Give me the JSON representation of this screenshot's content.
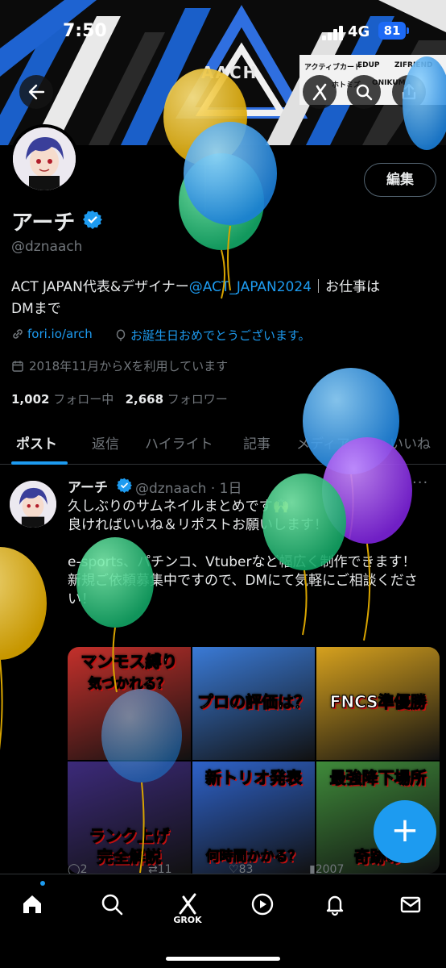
{
  "status_bar": {
    "time": "7:50",
    "network": "4G",
    "battery": "81"
  },
  "banner": {
    "title": "AACH",
    "sponsors": [
      "アクティブカード",
      "EDUP",
      "ZIFRIEND",
      "ホトミズ",
      "ONIKUMA"
    ]
  },
  "profile": {
    "display_name": "アーチ",
    "handle": "@dznaach",
    "edit_label": "編集",
    "bio_prefix": "ACT JAPAN代表&デザイナー",
    "bio_mention": "@ACT_JAPAN2024",
    "bio_suffix": "｜お仕事は",
    "bio_line2": "DMまで",
    "link": "fori.io/arch",
    "birthday": "お誕生日おめでとうございます。",
    "joined": "2018年11月からXを利用しています",
    "following_count": "1,002",
    "following_label": "フォロー中",
    "followers_count": "2,668",
    "followers_label": "フォロワー"
  },
  "tabs": [
    "ポスト",
    "返信",
    "ハイライト",
    "記事",
    "メディア",
    "いいね"
  ],
  "post": {
    "name": "アーチ",
    "handle_time": "@dznaach · 1日",
    "more": "···",
    "text": "久しぶりのサムネイルまとめです🙌\n良ければいいね＆リポストお願いします！\n\ne-sports、パチンコ、Vtuberなど幅広く制作できます！\n新規ご依頼募集中ですので、DMにて気軽にご相談ください！",
    "thumbnails": [
      {
        "caption": "マンモス縛り",
        "sub": "気づかれる？",
        "bg": "#c4302b"
      },
      {
        "caption": "プロの評価は？",
        "sub": "",
        "bg": "#3a7ad6"
      },
      {
        "caption": "FNCS準優勝",
        "sub": "",
        "bg": "#d6a11e"
      },
      {
        "caption": "ランク上げ",
        "sub": "完全解説",
        "bg": "#3c2a7a"
      },
      {
        "caption": "新トリオ発表",
        "sub": "何時間かかる？",
        "bg": "#2e62c9"
      },
      {
        "caption": "最強降下場所",
        "sub": "奇跡の",
        "bg": "#3f8a3a"
      }
    ],
    "actions": [
      "2",
      "11",
      "83",
      "2007"
    ]
  },
  "nav": {
    "grok_label": "GROK"
  },
  "colors": {
    "accent": "#1d9bf0",
    "background": "#000000",
    "muted": "#71767b"
  }
}
